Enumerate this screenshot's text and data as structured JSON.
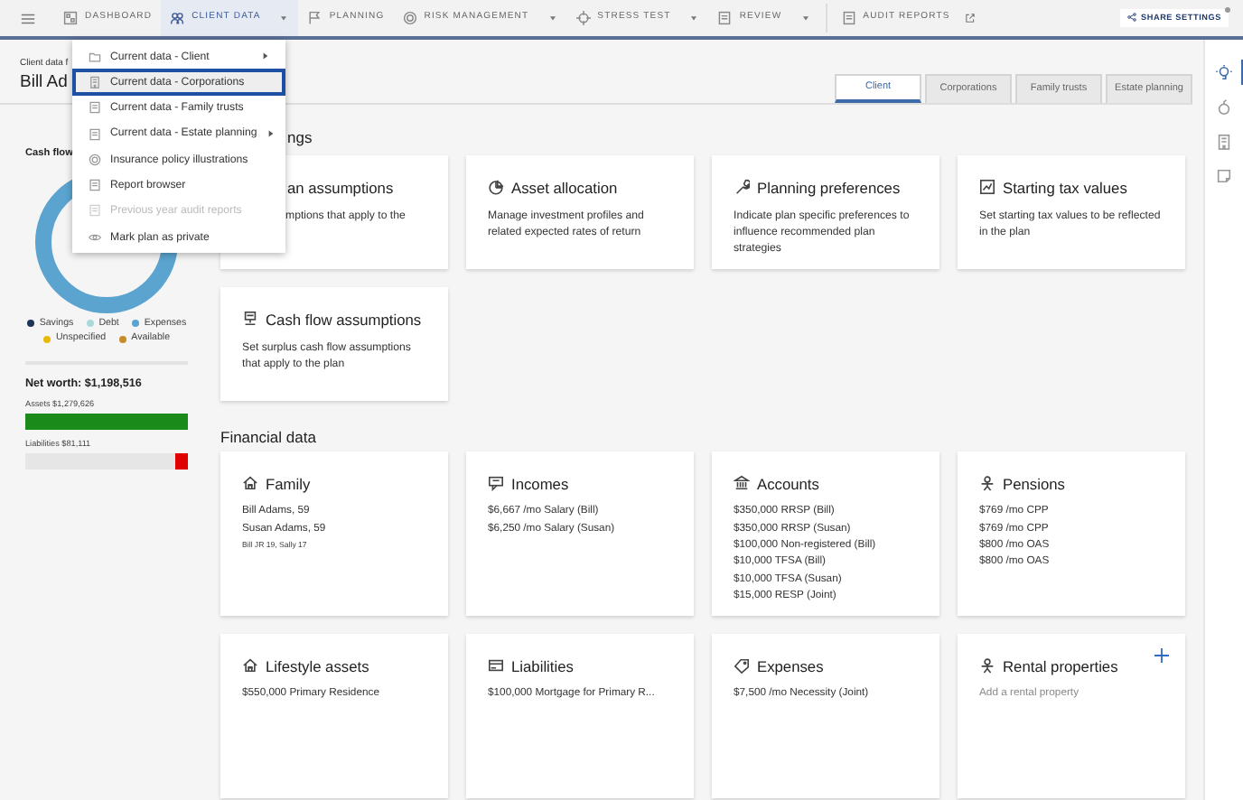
{
  "top_nav": {
    "items": [
      {
        "label": "DASHBOARD",
        "selected": false,
        "dropdown": false,
        "external": false
      },
      {
        "label": "CLIENT DATA",
        "selected": true,
        "dropdown": true,
        "external": false
      },
      {
        "label": "PLANNING",
        "selected": false,
        "dropdown": false,
        "external": false
      },
      {
        "label": "RISK MANAGEMENT",
        "selected": false,
        "dropdown": true,
        "external": false
      },
      {
        "label": "STRESS TEST",
        "selected": false,
        "dropdown": true,
        "external": false
      },
      {
        "label": "REVIEW",
        "selected": false,
        "dropdown": true,
        "external": false
      },
      {
        "label": "AUDIT REPORTS",
        "selected": false,
        "dropdown": false,
        "external": true
      }
    ],
    "share_button": "SHARE SETTINGS"
  },
  "dropdown_menu": [
    {
      "label": "Current data - Client",
      "submenu": true,
      "focused": false,
      "disabled": false
    },
    {
      "label": "Current data - Corporations",
      "submenu": false,
      "focused": true,
      "disabled": false
    },
    {
      "label": "Current data - Family trusts",
      "submenu": false,
      "focused": false,
      "disabled": false
    },
    {
      "label": "Current data - Estate planning",
      "submenu": true,
      "focused": false,
      "disabled": false
    },
    {
      "label": "Insurance policy illustrations",
      "submenu": false,
      "focused": false,
      "disabled": false
    },
    {
      "label": "Report browser",
      "submenu": false,
      "focused": false,
      "disabled": false
    },
    {
      "label": "Previous year audit reports",
      "submenu": false,
      "focused": false,
      "disabled": true
    },
    {
      "label": "Mark plan as private",
      "submenu": false,
      "focused": false,
      "disabled": false
    }
  ],
  "header": {
    "subtitle": "Client data f",
    "title": "Bill Ad"
  },
  "tabs": [
    {
      "label": "Client",
      "selected": true
    },
    {
      "label": "Corporations",
      "selected": false
    },
    {
      "label": "Family trusts",
      "selected": false
    },
    {
      "label": "Estate planning",
      "selected": false
    }
  ],
  "left_panel": {
    "title": "Cash flow",
    "legend": [
      {
        "label": "Savings",
        "color": "#1d3557"
      },
      {
        "label": "Debt",
        "color": "#a8dadc"
      },
      {
        "label": "Expenses",
        "color": "#5ba4cf"
      },
      {
        "label": "Unspecified",
        "color": "#e9b90a"
      },
      {
        "label": "Available",
        "color": "#c98a2b"
      }
    ],
    "net_worth": "Net worth: $1,198,516",
    "assets": {
      "label": "Assets $1,279,626",
      "level": 1
    },
    "liabilities": {
      "label": "Liabilities $81,111",
      "level": 0.08
    }
  },
  "plan_settings": {
    "heading": "ngs",
    "cards": [
      {
        "title": "an assumptions",
        "description": "mptions that apply to the",
        "covered": true
      },
      {
        "title": "Asset allocation",
        "description": "Manage investment profiles and related expected rates of return",
        "covered": false
      },
      {
        "title": "Planning preferences",
        "description": "Indicate plan specific preferences to influence recommended plan strategies",
        "covered": false
      },
      {
        "title": "Starting tax values",
        "description": "Set starting tax values to be reflected in the plan",
        "covered": false
      },
      {
        "title": "Cash flow assumptions",
        "description": "Set surplus cash flow assumptions that apply to the plan",
        "covered": false
      }
    ]
  },
  "financial_data": {
    "heading": "Financial data",
    "cards": [
      {
        "title": "Family",
        "lines": [
          "Bill Adams, 59",
          "Susan Adams, 59"
        ],
        "note": "Bill JR 19, Sally 17",
        "addable": false
      },
      {
        "title": "Incomes",
        "lines": [
          "$6,667 /mo Salary (Bill)",
          "$6,250 /mo Salary (Susan)"
        ],
        "addable": false
      },
      {
        "title": "Accounts",
        "lines": [
          "$350,000 RRSP (Bill)",
          "$350,000 RRSP (Susan)",
          "$100,000 Non-registered (Bill)",
          "$10,000 TFSA (Bill)",
          "$10,000 TFSA (Susan)",
          "$15,000 RESP (Joint)"
        ],
        "addable": false
      },
      {
        "title": "Pensions",
        "lines": [
          "$769 /mo CPP",
          "$769 /mo CPP",
          "$800 /mo OAS",
          "$800 /mo OAS"
        ],
        "addable": false
      },
      {
        "title": "Lifestyle assets",
        "lines": [
          "$550,000 Primary Residence"
        ],
        "addable": false
      },
      {
        "title": "Liabilities",
        "lines": [
          "$100,000 Mortgage for Primary R..."
        ],
        "addable": false
      },
      {
        "title": "Expenses",
        "lines": [
          "$7,500 /mo Necessity (Joint)"
        ],
        "addable": false
      },
      {
        "title": "Rental properties",
        "placeholder": "Add a rental property",
        "addable": true
      }
    ]
  },
  "sidebar": [
    {
      "selected": true
    },
    {
      "selected": false
    },
    {
      "selected": false
    },
    {
      "selected": false
    }
  ]
}
